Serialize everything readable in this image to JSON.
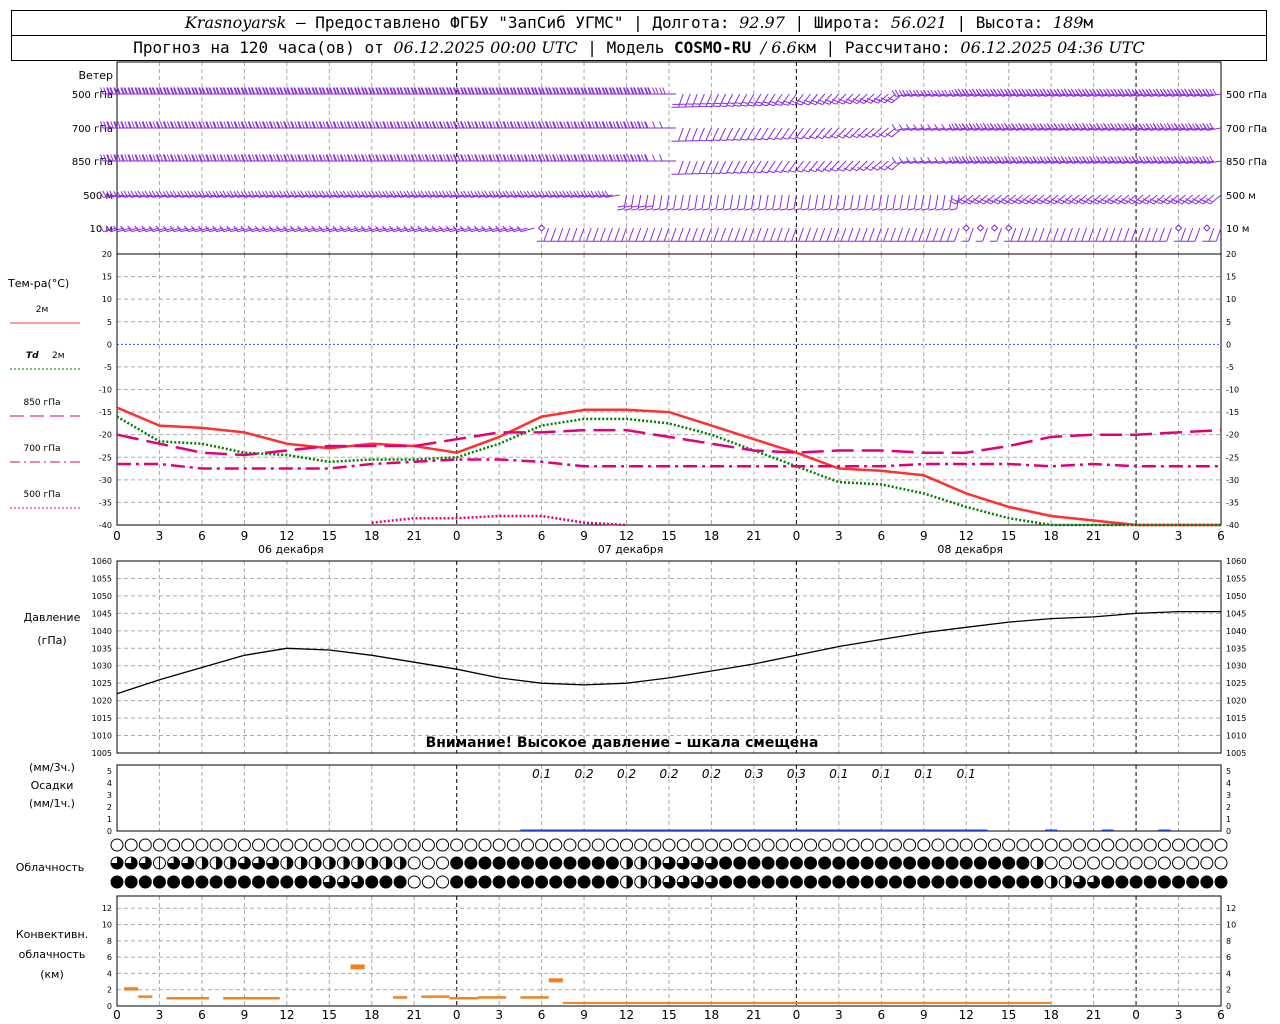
{
  "header": {
    "station": "Krasnoyarsk",
    "provider": "– Предоставлено ФГБУ \"ЗапСиб УГМС\"",
    "lon_label": "Долгота:",
    "lon": "92.97",
    "lat_label": "Широта:",
    "lat": "56.021",
    "alt_label": "Высота:",
    "alt": "189",
    "alt_unit": "м",
    "forecast_label": "Прогноз на 120 часа(ов) от",
    "forecast_start": "06.12.2025 00:00 UTC",
    "model_label": "Модель",
    "model": "COSMO-RU",
    "model_res": "/ 6.6",
    "model_res_unit": "км",
    "calc_label": "Рассчитано:",
    "calc_time": "06.12.2025 04:36 UTC"
  },
  "time_axis": {
    "hour_ticks": [
      "0",
      "3",
      "6",
      "9",
      "12",
      "15",
      "18",
      "21",
      "0",
      "3",
      "6",
      "9",
      "12",
      "15",
      "18",
      "21",
      "0",
      "3",
      "6",
      "9",
      "12",
      "15",
      "18",
      "21",
      "0",
      "3",
      "6"
    ],
    "dates": [
      "06 декабря",
      "07 декабря",
      "08 декабря"
    ]
  },
  "wind": {
    "title": "Ветер",
    "levels": [
      "500 гПа",
      "700 гПа",
      "850 гПа",
      "500 м",
      "10  м"
    ],
    "color": "#8a2be2"
  },
  "temperature": {
    "title": "Тем-ра(°C)",
    "yticks": [
      "20",
      "15",
      "10",
      "5",
      "0",
      "-5",
      "-10",
      "-15",
      "-20",
      "-25",
      "-30",
      "-35",
      "-40"
    ],
    "legend": [
      {
        "label": "2м",
        "color": "#ff3030",
        "style": "solid"
      },
      {
        "label_prefix": "Td",
        "label": "2м",
        "color": "#008000",
        "style": "dotted"
      },
      {
        "label": "850 гПа",
        "color": "#e0007a",
        "style": "longdash"
      },
      {
        "label": "700 гПа",
        "color": "#e0007a",
        "style": "dashdot"
      },
      {
        "label": "500 гПа",
        "color": "#e0007a",
        "style": "dotted"
      }
    ]
  },
  "pressure": {
    "title": "Давление",
    "unit": "(гПа)",
    "yticks": [
      "1060",
      "1055",
      "1050",
      "1045",
      "1040",
      "1035",
      "1030",
      "1025",
      "1020",
      "1015",
      "1010",
      "1005"
    ],
    "warning": "Внимание! Высокое давление – шкала смещена"
  },
  "precip": {
    "unit1": "(мм/3ч.)",
    "title": "Осадки",
    "unit2": "(мм/1ч.)",
    "yticks": [
      "5",
      "4",
      "3",
      "2",
      "1",
      "0"
    ],
    "labels": [
      {
        "h": 30,
        "v": "0.1"
      },
      {
        "h": 33,
        "v": "0.2"
      },
      {
        "h": 36,
        "v": "0.2"
      },
      {
        "h": 39,
        "v": "0.2"
      },
      {
        "h": 42,
        "v": "0.2"
      },
      {
        "h": 45,
        "v": "0.3"
      },
      {
        "h": 48,
        "v": "0.3"
      },
      {
        "h": 51,
        "v": "0.1"
      },
      {
        "h": 54,
        "v": "0.1"
      },
      {
        "h": 57,
        "v": "0.1"
      },
      {
        "h": 60,
        "v": "0.1"
      }
    ]
  },
  "cloud": {
    "title": "Облачность",
    "rows": [
      "0000000000000000000000000000000000000000000000000000000000000000000000000000000000",
      "3331332223332222222220004444444444442223333444444444444444444444420000000000000000",
      "4444444444444443334440004444444444442223333444444444444444444444442233444444444444"
    ]
  },
  "convective": {
    "title": "Конвективн.",
    "title2": "облачность",
    "unit": "(км)",
    "yticks": [
      "12",
      "10",
      "8",
      "6",
      "4",
      "2",
      "0"
    ],
    "bars": [
      {
        "h0": 0.5,
        "h1": 1.5,
        "lo": 1.9,
        "hi": 2.3
      },
      {
        "h0": 1.5,
        "h1": 2.5,
        "lo": 1.0,
        "hi": 1.3
      },
      {
        "h0": 3.5,
        "h1": 6.5,
        "lo": 0.8,
        "hi": 1.1
      },
      {
        "h0": 7.5,
        "h1": 11.5,
        "lo": 0.8,
        "hi": 1.1
      },
      {
        "h0": 16.5,
        "h1": 17.5,
        "lo": 4.5,
        "hi": 5.1
      },
      {
        "h0": 19.5,
        "h1": 20.5,
        "lo": 0.9,
        "hi": 1.2
      },
      {
        "h0": 21.5,
        "h1": 23.5,
        "lo": 1.0,
        "hi": 1.3
      },
      {
        "h0": 23.5,
        "h1": 25.5,
        "lo": 0.8,
        "hi": 1.1
      },
      {
        "h0": 25.5,
        "h1": 27.5,
        "lo": 0.9,
        "hi": 1.2
      },
      {
        "h0": 28.5,
        "h1": 30.5,
        "lo": 0.9,
        "hi": 1.2
      },
      {
        "h0": 30.5,
        "h1": 31.5,
        "lo": 2.9,
        "hi": 3.4
      },
      {
        "h0": 31.5,
        "h1": 32.5,
        "lo": 0.3,
        "hi": 0.5
      },
      {
        "h0": 32.5,
        "h1": 66,
        "lo": 0.3,
        "hi": 0.5
      }
    ]
  },
  "chart_data": {
    "type": "line",
    "x_hours": [
      0,
      3,
      6,
      9,
      12,
      15,
      18,
      21,
      24,
      27,
      30,
      33,
      36,
      39,
      42,
      45,
      48,
      51,
      54,
      57,
      60,
      63,
      66,
      69,
      72,
      75,
      78
    ],
    "temperature": {
      "ylim": [
        -40,
        20
      ],
      "series": [
        {
          "name": "2м",
          "values": [
            -14,
            -18,
            -18.5,
            -19.5,
            -22,
            -23,
            -22,
            -22.5,
            -24,
            -20.5,
            -16,
            -14.5,
            -14.5,
            -15,
            -18,
            -21,
            -24,
            -27.5,
            -28,
            -29,
            -33,
            -36,
            -38,
            -39,
            -40,
            -41.5,
            -40.5
          ]
        },
        {
          "name": "Td 2м",
          "values": [
            -16,
            -21.5,
            -22,
            -24,
            -24.5,
            -26,
            -25.5,
            -25.5,
            -25,
            -22,
            -18,
            -16.5,
            -16.5,
            -17.5,
            -20,
            -23.5,
            -27,
            -30.5,
            -31,
            -33,
            -36,
            -38.5,
            -40,
            -41.5,
            -43,
            -44.5,
            -44
          ]
        },
        {
          "name": "850 гПа",
          "values": [
            -20,
            -22,
            -24,
            -24.5,
            -23.5,
            -22.5,
            -22.5,
            -22.5,
            -21,
            -19.5,
            -19.5,
            -19,
            -19,
            -20.5,
            -22,
            -23.5,
            -24,
            -23.5,
            -23.5,
            -24,
            -24,
            -22.5,
            -20.5,
            -20,
            -20,
            -19.5,
            -19
          ]
        },
        {
          "name": "700 гПа",
          "values": [
            -26.5,
            -26.5,
            -27.5,
            -27.5,
            -27.5,
            -27.5,
            -26.5,
            -26,
            -25.5,
            -25.5,
            -26,
            -27,
            -27,
            -27,
            -27,
            -27,
            -27,
            -27,
            -27,
            -26.5,
            -26.5,
            -26.5,
            -27,
            -26.5,
            -27,
            -27,
            -27
          ]
        },
        {
          "name": "500 гПа",
          "values": [
            null,
            null,
            null,
            null,
            null,
            null,
            -39.5,
            -38.5,
            -38.5,
            -38,
            -38,
            -39.5,
            -40.5,
            null,
            null,
            null,
            null,
            null,
            null,
            null,
            null,
            null,
            null,
            null,
            null,
            null,
            null
          ]
        }
      ]
    },
    "pressure": {
      "ylim": [
        1005,
        1060
      ],
      "values": [
        1022,
        1026,
        1029.5,
        1033,
        1035,
        1034.5,
        1033,
        1031,
        1029,
        1026.5,
        1025,
        1024.5,
        1025,
        1026.5,
        1028.5,
        1030.5,
        1033,
        1035.5,
        1037.5,
        1039.5,
        1041,
        1042.5,
        1043.5,
        1044,
        1045,
        1045.5,
        1045.5
      ]
    },
    "precip_3h": {
      "x_hours": [
        30,
        33,
        36,
        39,
        42,
        45,
        48,
        51,
        54,
        57,
        60
      ],
      "values": [
        0.1,
        0.2,
        0.2,
        0.2,
        0.2,
        0.3,
        0.3,
        0.1,
        0.1,
        0.1,
        0.1
      ]
    }
  }
}
